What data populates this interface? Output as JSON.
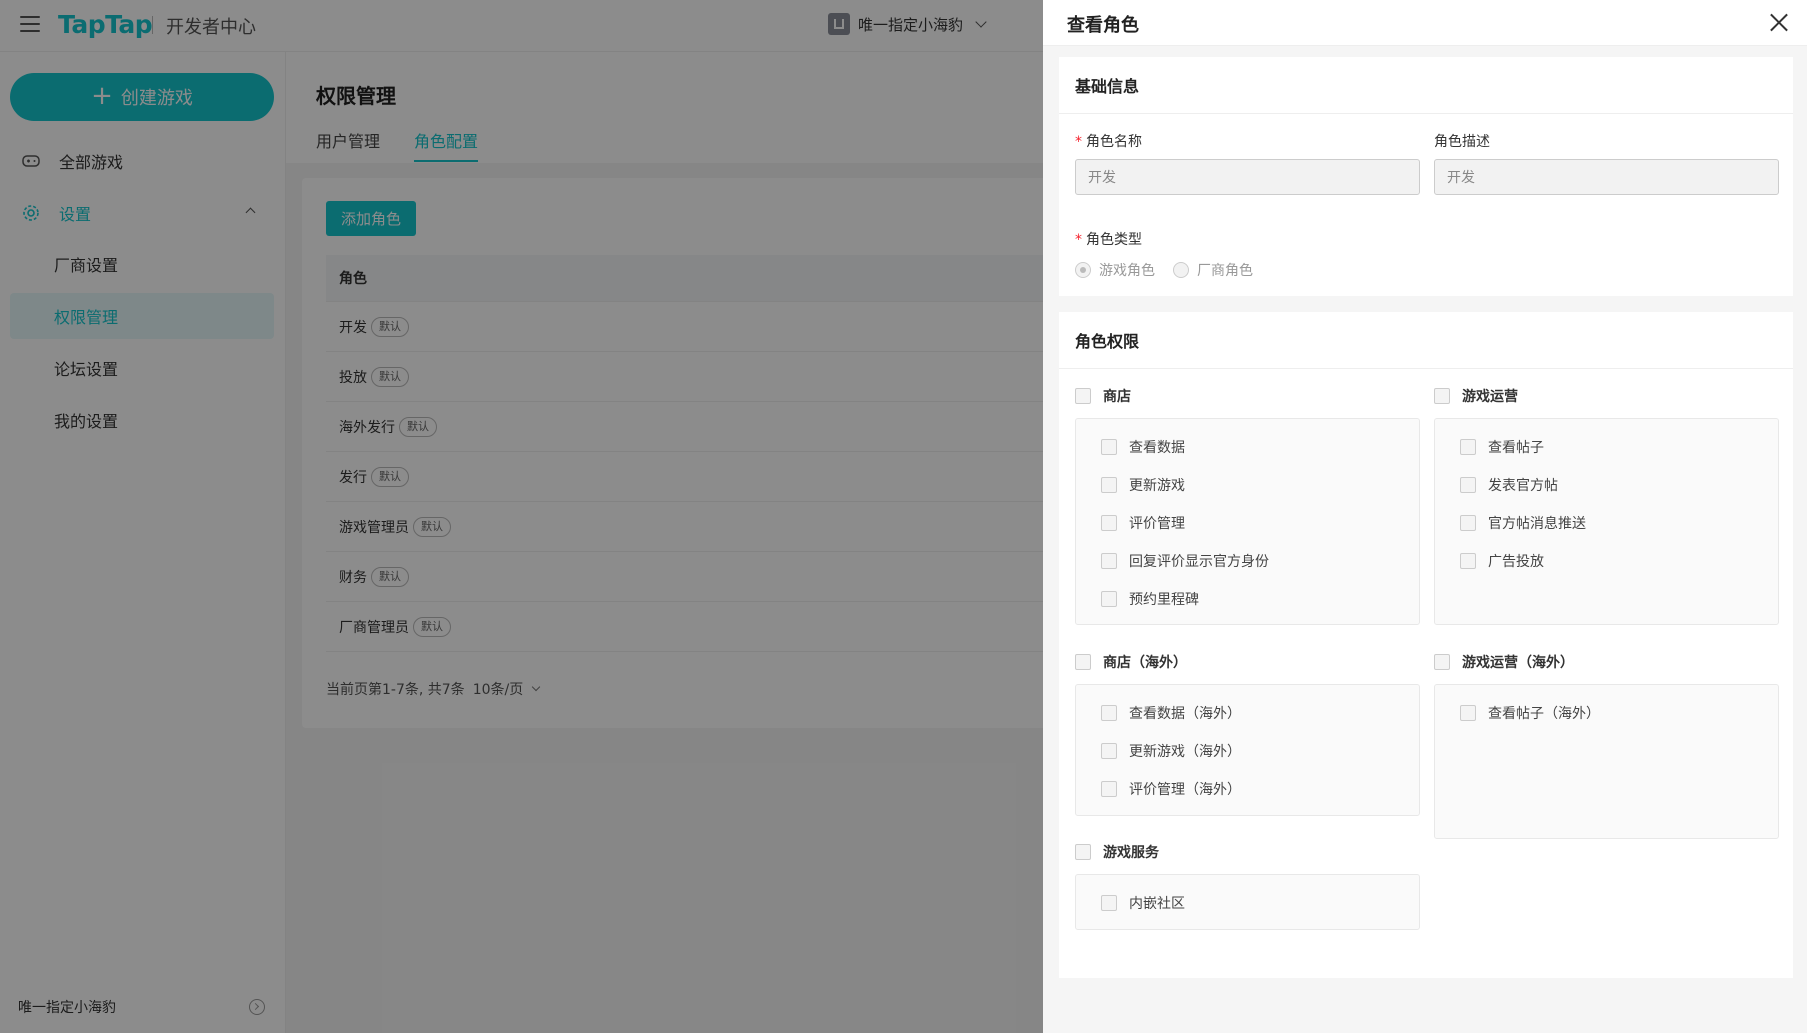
{
  "app": {
    "logo": "TapTap",
    "section": "开发者中心",
    "vendor": "唯一指定小海豹"
  },
  "sidebar": {
    "create_button": "创建游戏",
    "items": [
      {
        "label": "全部游戏",
        "icon": "gamepad-icon"
      },
      {
        "label": "设置",
        "icon": "gear-icon"
      },
      {
        "label": "厂商设置"
      },
      {
        "label": "权限管理"
      },
      {
        "label": "论坛设置"
      },
      {
        "label": "我的设置"
      }
    ],
    "footer": "唯一指定小海豹"
  },
  "main": {
    "title": "权限管理",
    "tabs": [
      {
        "label": "用户管理"
      },
      {
        "label": "角色配置"
      }
    ],
    "add_button": "添加角色",
    "table_header": "角色",
    "rows": [
      {
        "name": "开发",
        "badge": "默认"
      },
      {
        "name": "投放",
        "badge": "默认"
      },
      {
        "name": "海外发行",
        "badge": "默认"
      },
      {
        "name": "发行",
        "badge": "默认"
      },
      {
        "name": "游戏管理员",
        "badge": "默认"
      },
      {
        "name": "财务",
        "badge": "默认"
      },
      {
        "name": "厂商管理员",
        "badge": "默认"
      }
    ],
    "pager_text": "当前页第1-7条, 共7条",
    "page_size": "10条/页"
  },
  "drawer": {
    "title": "查看角色",
    "basic": {
      "title": "基础信息",
      "name_label": "角色名称",
      "name_value": "开发",
      "desc_label": "角色描述",
      "desc_value": "开发",
      "type_label": "角色类型",
      "type_options": [
        "游戏角色",
        "厂商角色"
      ],
      "type_selected": "游戏角色"
    },
    "perms": {
      "title": "角色权限",
      "groups": [
        {
          "label": "商店",
          "items": [
            "查看数据",
            "更新游戏",
            "评价管理",
            "回复评价显示官方身份",
            "预约里程碑"
          ]
        },
        {
          "label": "游戏运营",
          "items": [
            "查看帖子",
            "发表官方帖",
            "官方帖消息推送",
            "广告投放"
          ]
        },
        {
          "label": "商店（海外）",
          "items": [
            "查看数据（海外）",
            "更新游戏（海外）",
            "评价管理（海外）"
          ]
        },
        {
          "label": "游戏运营（海外）",
          "items": [
            "查看帖子（海外）"
          ]
        },
        {
          "label": "游戏服务",
          "items": [
            "内嵌社区"
          ]
        }
      ]
    }
  }
}
